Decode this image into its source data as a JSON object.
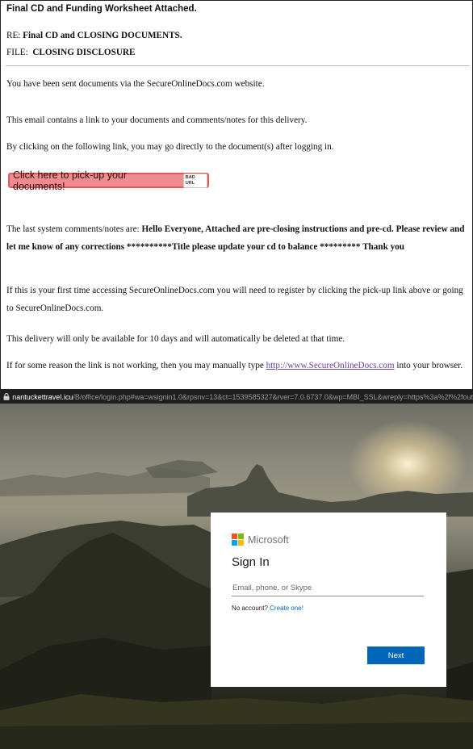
{
  "email": {
    "subject": "Final CD and Funding Worksheet Attached.",
    "re_label": "RE:",
    "re_value": "Final CD and CLOSING DOCUMENTS.",
    "file_label": "FILE:",
    "file_value": "CLOSING DISCLOSURE",
    "p1": "You have been sent documents via the SecureOnlineDocs.com website.",
    "p2": "This email contains a link to your documents and comments/notes for this delivery.",
    "p3": "By clicking on the following link, you may go directly to the document(s) after logging in.",
    "pickup_button": "Click here to pick-up your documents!",
    "bad_url_tag": "BAD URL",
    "comments_prefix": "The last system comments/notes are:",
    "comments_text": "Hello Everyone, Attached are pre-closing instructions and pre-cd. Please review and let me know of any corrections **********Title please update your cd to balance ********* Thank you",
    "first_time": "If this is your first time accessing SecureOnlineDocs.com you will need to register by clicking the pick-up link above or going to SecureOnlineDocs.com.",
    "delivery": "This delivery will only be available for 10 days and will automatically be deleted at that time.",
    "manual_prefix": "If for some reason the link is not working, then you may manually type",
    "manual_link": "http://www.SecureOnlineDocs.com",
    "manual_suffix": "into your browser."
  },
  "browser": {
    "url_domain": "nantuckettravel.icu",
    "url_path": "/B/office/login.php#wa=wsignin1.0&rpsnv=13&ct=1539585327&rver=7.0.6737.0&wp=MBI_SSL&wreply=https%3a%2f%2fout"
  },
  "login": {
    "brand": "Microsoft",
    "title": "Sign In",
    "input_placeholder": "Email, phone, or Skype",
    "no_account": "No account?",
    "create_link": "Create one!",
    "next_button": "Next"
  },
  "colors": {
    "pickup_button_bg": "#f08c8f",
    "ms_red": "#f25022",
    "ms_green": "#7fba00",
    "ms_blue": "#00a4ef",
    "ms_yellow": "#ffb900",
    "ms_accent": "#0067b8"
  }
}
